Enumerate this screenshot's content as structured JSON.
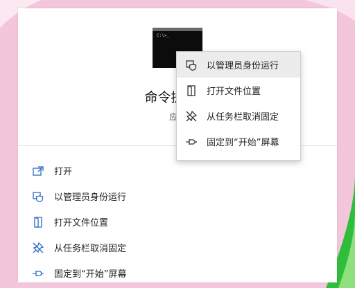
{
  "app": {
    "prompt": "C:\\>_",
    "title": "命令提示符",
    "subtitle": "应用"
  },
  "context_menu": {
    "items": [
      {
        "label": "以管理员身份运行",
        "icon": "shield-icon"
      },
      {
        "label": "打开文件位置",
        "icon": "folder-icon"
      },
      {
        "label": "从任务栏取消固定",
        "icon": "unpin-icon"
      },
      {
        "label": "固定到“开始”屏幕",
        "icon": "pin-icon"
      }
    ]
  },
  "actions": {
    "items": [
      {
        "label": "打开",
        "icon": "open-icon"
      },
      {
        "label": "以管理员身份运行",
        "icon": "shield-icon"
      },
      {
        "label": "打开文件位置",
        "icon": "folder-icon"
      },
      {
        "label": "从任务栏取消固定",
        "icon": "unpin-icon"
      },
      {
        "label": "固定到“开始”屏幕",
        "icon": "pin-icon"
      }
    ]
  },
  "colors": {
    "background": "#f4c6dc",
    "accent": "#2b6cc4",
    "panel": "#ffffff",
    "highlight": "#ececec"
  }
}
